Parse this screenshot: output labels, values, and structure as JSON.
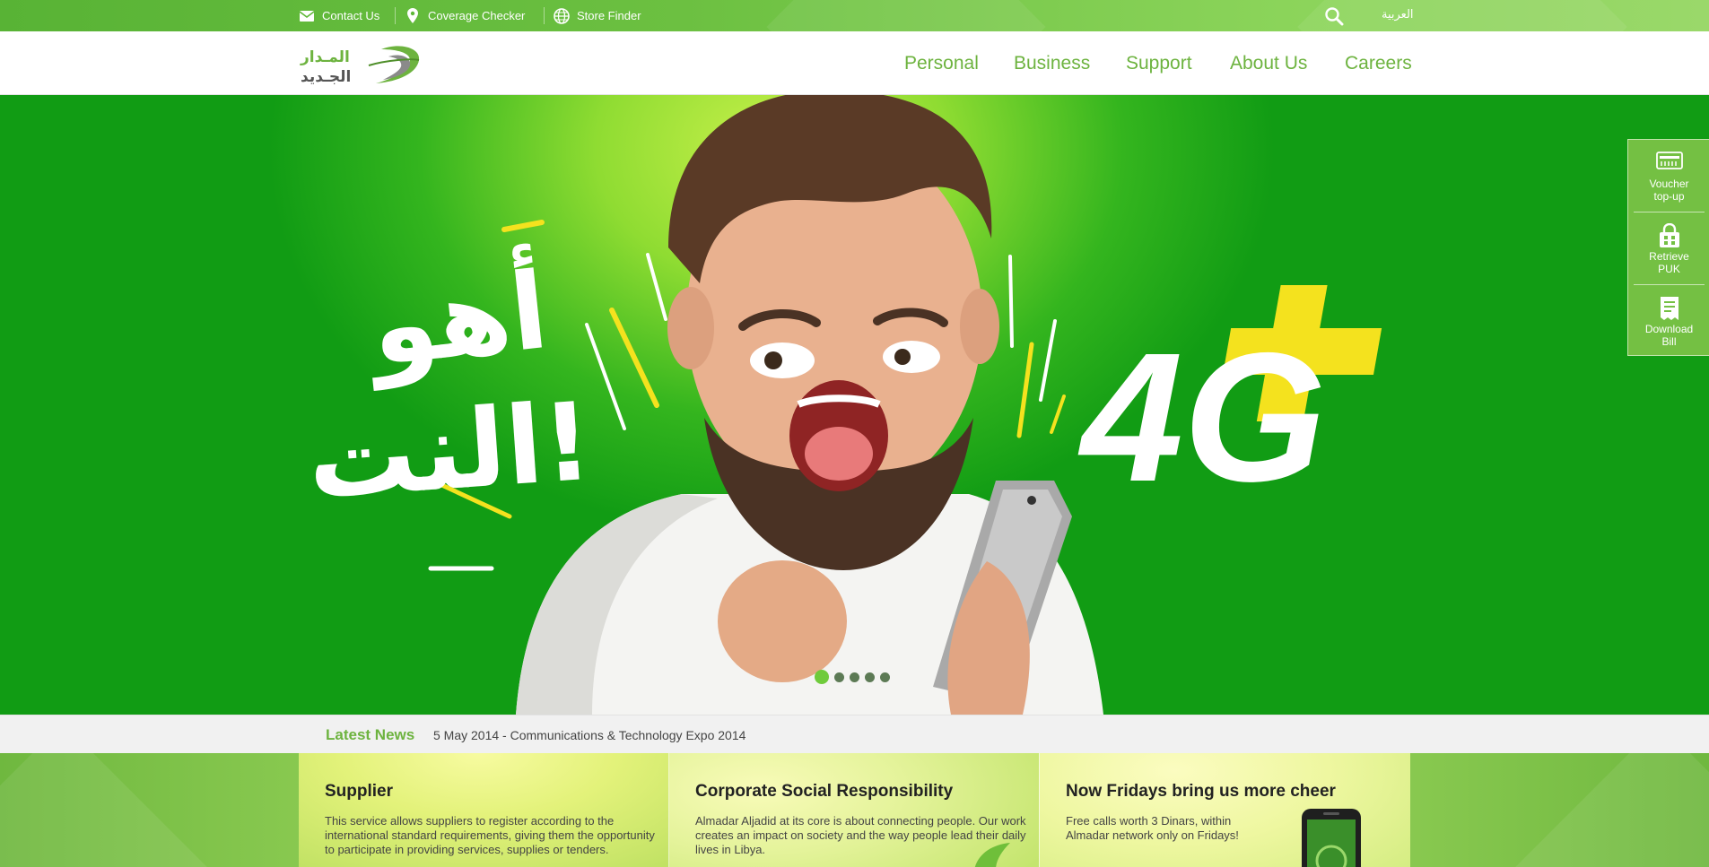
{
  "topbar": {
    "links": [
      {
        "label": "Contact Us",
        "icon": "envelope-icon"
      },
      {
        "label": "Coverage Checker",
        "icon": "map-pin-icon"
      },
      {
        "label": "Store Finder",
        "icon": "globe-icon"
      }
    ],
    "search_icon": "search-icon",
    "language": "العربية"
  },
  "header": {
    "logo_text_line1": "المـدار",
    "logo_text_line2": "الجـديد",
    "nav": [
      "Personal",
      "Business",
      "Support",
      "About Us",
      "Careers"
    ]
  },
  "hero": {
    "headline_arabic_line1": "أهو",
    "headline_arabic_line2": "النت!",
    "badge": "4G",
    "badge_plus": "+",
    "slides_total": 5,
    "active_slide": 1
  },
  "quick_links": [
    {
      "label_line1": "Voucher",
      "label_line2": "top-up",
      "icon": "voucher-icon"
    },
    {
      "label_line1": "Retrieve",
      "label_line2": "PUK",
      "icon": "sim-lock-icon"
    },
    {
      "label_line1": "Download",
      "label_line2": "Bill",
      "icon": "bill-icon"
    }
  ],
  "news": {
    "label": "Latest News",
    "item": "5 May 2014 - Communications & Technology Expo 2014"
  },
  "cards": [
    {
      "title": "Supplier",
      "text": "This service allows suppliers to register according to the international standard requirements, giving them the opportunity to participate in providing services, supplies or tenders."
    },
    {
      "title": "Corporate Social Responsibility",
      "text": "Almadar Aljadid at its core is about connecting people. Our work creates an impact on society and the way people lead their daily lives in Libya."
    },
    {
      "title": "Now Fridays bring us more cheer",
      "text": "Free calls worth 3 Dinars, within Almadar network only on Fridays!"
    }
  ],
  "colors": {
    "brand_green": "#6db33f",
    "topbar_green": "#5fb839",
    "hero_dark": "#119c14",
    "hero_light": "#c7f04a",
    "accent_yellow": "#f4e21e"
  }
}
